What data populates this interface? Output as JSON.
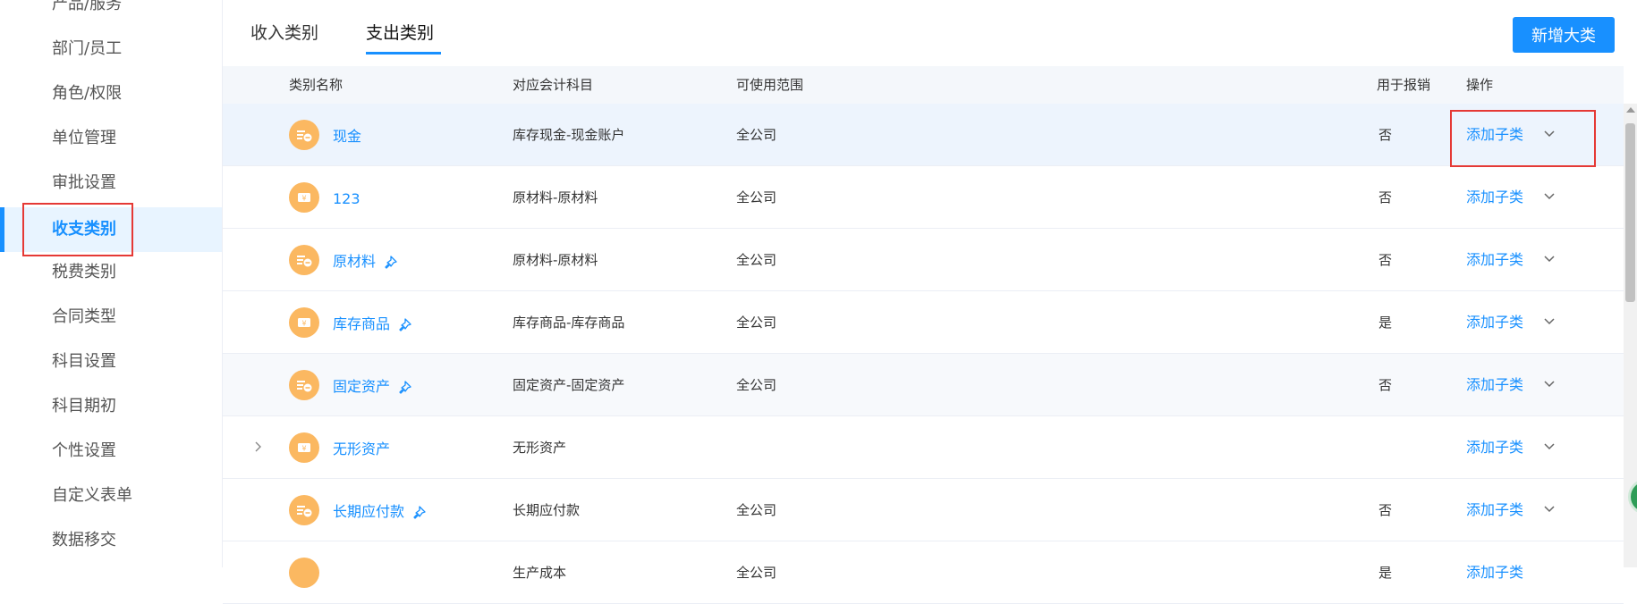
{
  "sidebar": {
    "items": [
      {
        "label": "产品/服务"
      },
      {
        "label": "部门/员工"
      },
      {
        "label": "角色/权限"
      },
      {
        "label": "单位管理"
      },
      {
        "label": "审批设置"
      },
      {
        "label": "收支类别"
      },
      {
        "label": "税费类别"
      },
      {
        "label": "合同类型"
      },
      {
        "label": "科目设置"
      },
      {
        "label": "科目期初"
      },
      {
        "label": "个性设置"
      },
      {
        "label": "自定义表单"
      },
      {
        "label": "数据移交"
      }
    ],
    "active": "收支类别"
  },
  "tabs": [
    {
      "label": "收入类别"
    },
    {
      "label": "支出类别"
    }
  ],
  "active_tab": "支出类别",
  "add_button": "新增大类",
  "table": {
    "headers": {
      "name": "类别名称",
      "account": "对应会计科目",
      "scope": "可使用范围",
      "reimburse": "用于报销",
      "ops": "操作"
    },
    "rows": [
      {
        "name": "现金",
        "account": "库存现金-现金账户",
        "scope": "全公司",
        "reimburse": "否",
        "op": "添加子类"
      },
      {
        "name": "123",
        "account": "原材料-原材料",
        "scope": "全公司",
        "reimburse": "否",
        "op": "添加子类"
      },
      {
        "name": "原材料",
        "account": "原材料-原材料",
        "scope": "全公司",
        "reimburse": "否",
        "op": "添加子类"
      },
      {
        "name": "库存商品",
        "account": "库存商品-库存商品",
        "scope": "全公司",
        "reimburse": "是",
        "op": "添加子类"
      },
      {
        "name": "固定资产",
        "account": "固定资产-固定资产",
        "scope": "全公司",
        "reimburse": "否",
        "op": "添加子类"
      },
      {
        "name": "无形资产",
        "account": "无形资产",
        "scope": "",
        "reimburse": "",
        "op": "添加子类"
      },
      {
        "name": "长期应付款",
        "account": "长期应付款",
        "scope": "全公司",
        "reimburse": "否",
        "op": "添加子类"
      },
      {
        "name": "",
        "account": "生产成本",
        "scope": "全公司",
        "reimburse": "是",
        "op": "添加子类"
      }
    ]
  },
  "colors": {
    "accent": "#1890ff",
    "icon_bg": "#fbb861",
    "highlight": "#e53935"
  }
}
